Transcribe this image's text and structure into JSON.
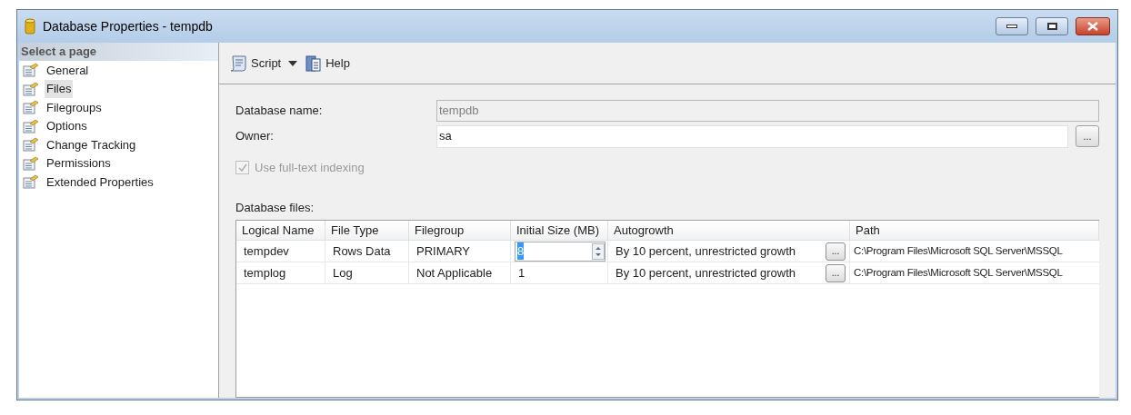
{
  "window": {
    "title": "Database Properties - tempdb"
  },
  "sidebar": {
    "heading": "Select a page",
    "items": [
      {
        "label": "General",
        "selected": false
      },
      {
        "label": "Files",
        "selected": true
      },
      {
        "label": "Filegroups",
        "selected": false
      },
      {
        "label": "Options",
        "selected": false
      },
      {
        "label": "Change Tracking",
        "selected": false
      },
      {
        "label": "Permissions",
        "selected": false
      },
      {
        "label": "Extended Properties",
        "selected": false
      }
    ]
  },
  "toolbar": {
    "script": "Script",
    "help": "Help"
  },
  "form": {
    "database_name_label": "Database name:",
    "database_name": "tempdb",
    "owner_label": "Owner:",
    "owner": "sa",
    "owner_browse": "...",
    "fulltext_label": "Use full-text indexing",
    "fulltext_checked": true,
    "fulltext_disabled": true
  },
  "files": {
    "label": "Database files:",
    "columns": [
      "Logical Name",
      "File Type",
      "Filegroup",
      "Initial Size (MB)",
      "Autogrowth",
      "Path"
    ],
    "rows": [
      {
        "logical_name": "tempdev",
        "file_type": "Rows Data",
        "filegroup": "PRIMARY",
        "initial_size": "8",
        "editing": true,
        "autogrowth": "By 10 percent, unrestricted growth",
        "browse": "...",
        "path": "C:\\Program Files\\Microsoft SQL Server\\MSSQL"
      },
      {
        "logical_name": "templog",
        "file_type": "Log",
        "filegroup": "Not Applicable",
        "initial_size": "1",
        "editing": false,
        "autogrowth": "By 10 percent, unrestricted growth",
        "browse": "...",
        "path": "C:\\Program Files\\Microsoft SQL Server\\MSSQL"
      }
    ]
  }
}
